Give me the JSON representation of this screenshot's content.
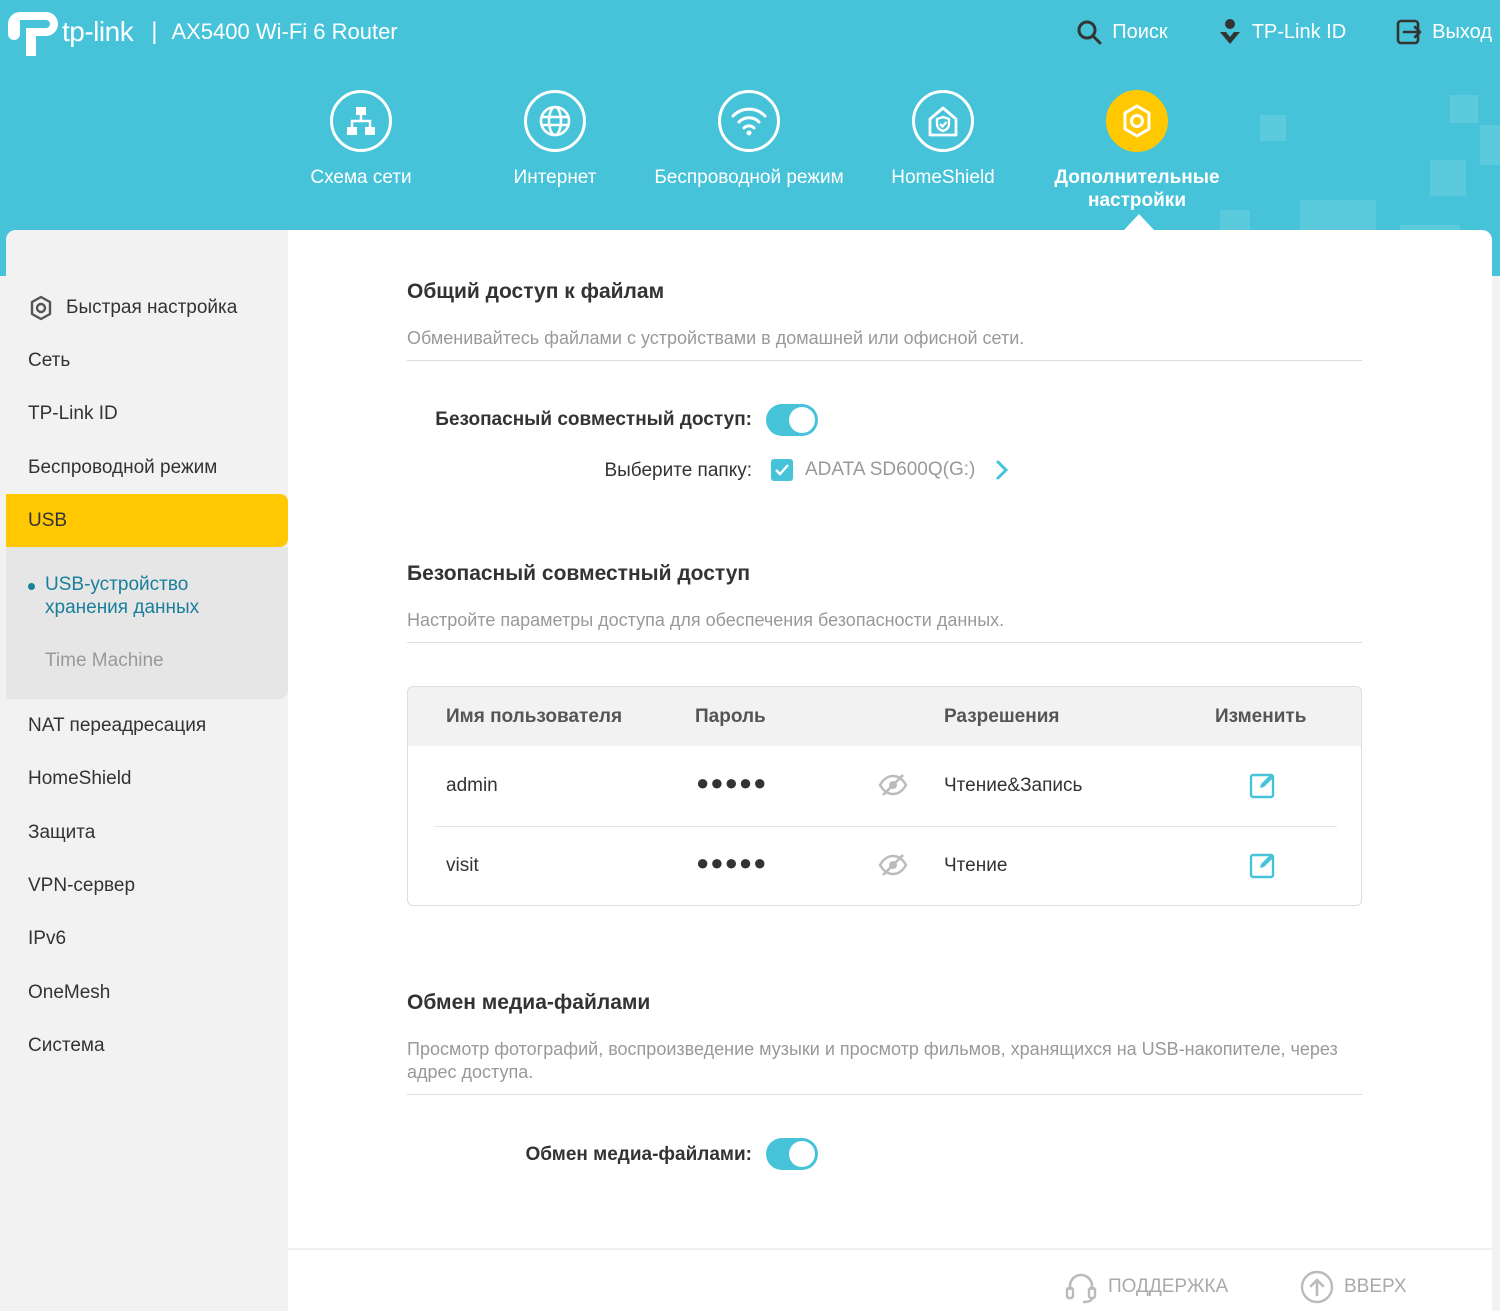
{
  "header": {
    "brand": "tp-link",
    "separator": "|",
    "model": "AX5400 Wi-Fi 6 Router",
    "actions": {
      "search": "Поиск",
      "tplink_id": "TP-Link ID",
      "logout": "Выход"
    },
    "nav": [
      {
        "label": "Схема сети",
        "icon": "network-map-icon"
      },
      {
        "label": "Интернет",
        "icon": "globe-icon"
      },
      {
        "label": "Беспроводной режим",
        "icon": "wifi-icon"
      },
      {
        "label": "HomeShield",
        "icon": "home-shield-icon"
      },
      {
        "label": "Дополнительные настройки",
        "icon": "gear-icon",
        "active": true
      }
    ]
  },
  "sidebar": {
    "items": [
      "Быстрая настройка",
      "Сеть",
      "TP-Link ID",
      "Беспроводной режим",
      "USB",
      "NAT переадресация",
      "HomeShield",
      "Защита",
      "VPN-сервер",
      "IPv6",
      "OneMesh",
      "Система"
    ],
    "usb_sub": [
      "USB-устройство хранения данных",
      "Time Machine"
    ]
  },
  "file_sharing": {
    "title": "Общий доступ к файлам",
    "desc": "Обменивайтесь файлами с устройствами в домашней или офисной сети.",
    "secure_label": "Безопасный совместный доступ:",
    "secure_enabled": true,
    "folder_label": "Выберите папку:",
    "folder_name": "ADATA SD600Q(G:)"
  },
  "secure_access": {
    "title": "Безопасный совместный доступ",
    "desc": "Настройте параметры доступа для обеспечения безопасности данных.",
    "columns": [
      "Имя пользователя",
      "Пароль",
      "Разрешения",
      "Изменить"
    ],
    "rows": [
      {
        "user": "admin",
        "password": "●●●●●",
        "permission": "Чтение&Запись"
      },
      {
        "user": "visit",
        "password": "●●●●●",
        "permission": "Чтение"
      }
    ]
  },
  "media_sharing": {
    "title": "Обмен медиа-файлами",
    "desc": "Просмотр фотографий, воспроизведение музыки и просмотр фильмов, хранящихся на USB-накопителе, через адрес доступа.",
    "label": "Обмен медиа-файлами:",
    "enabled": true
  },
  "footer": {
    "support": "ПОДДЕРЖКА",
    "top": "ВВЕРХ"
  },
  "colors": {
    "accent": "#46c3d9",
    "active": "#ffc800",
    "link": "#1a7f9b"
  }
}
